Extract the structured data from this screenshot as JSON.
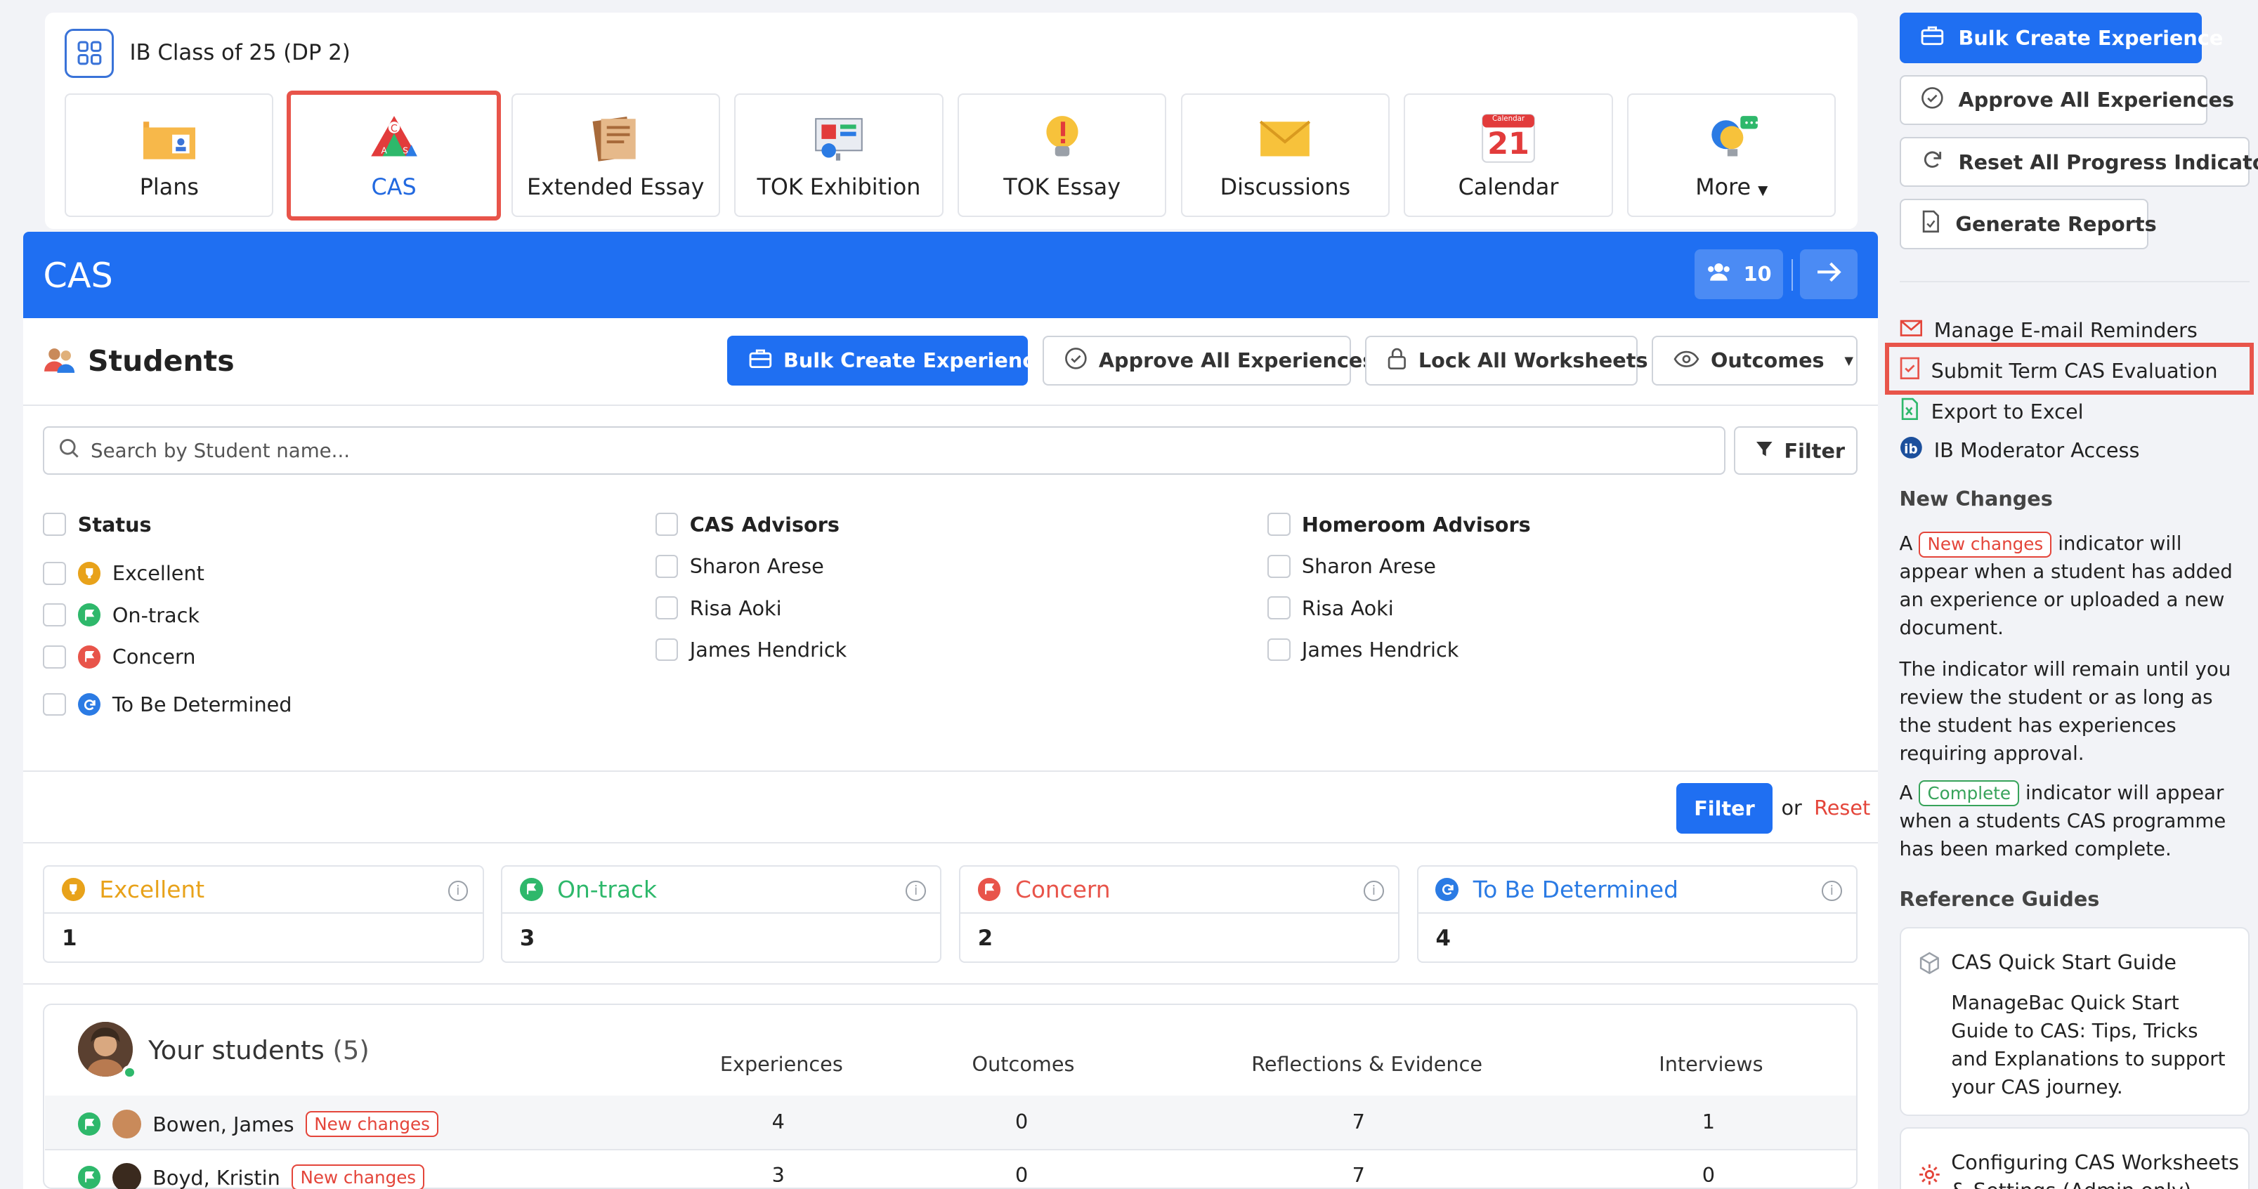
{
  "header": {
    "class_title": "IB Class of 25 (DP 2)",
    "tiles": [
      {
        "label": "Plans",
        "icon": "plans-folder-icon"
      },
      {
        "label": "CAS",
        "icon": "cas-triangle-icon"
      },
      {
        "label": "Extended Essay",
        "icon": "extended-essay-book-icon"
      },
      {
        "label": "TOK Exhibition",
        "icon": "tok-exhibition-board-icon"
      },
      {
        "label": "TOK Essay",
        "icon": "tok-essay-bulb-icon"
      },
      {
        "label": "Discussions",
        "icon": "discussions-envelope-icon"
      },
      {
        "label": "Calendar",
        "icon": "calendar-icon"
      },
      {
        "label": "More",
        "icon": "more-bulb-chat-icon"
      }
    ],
    "calendar_day": "21",
    "calendar_month": "Calendar"
  },
  "cas": {
    "title": "CAS",
    "student_count": "10",
    "students_title": "Students",
    "buttons": {
      "bulk_create": "Bulk Create Experience",
      "approve_all": "Approve All Experiences",
      "lock_all": "Lock All Worksheets",
      "outcomes": "Outcomes"
    },
    "search_placeholder": "Search by Student name...",
    "filter_label": "Filter",
    "filters": {
      "status": {
        "title": "Status",
        "items": [
          "Excellent",
          "On-track",
          "Concern",
          "To Be Determined"
        ]
      },
      "cas_advisors": {
        "title": "CAS Advisors",
        "items": [
          "Sharon Arese",
          "Risa Aoki",
          "James Hendrick"
        ]
      },
      "homeroom_advisors": {
        "title": "Homeroom Advisors",
        "items": [
          "Sharon Arese",
          "Risa Aoki",
          "James Hendrick"
        ]
      }
    },
    "apply_filter": "Filter",
    "or_text": "or",
    "reset": "Reset",
    "stats": [
      {
        "label": "Excellent",
        "value": "1",
        "color": "#e8a21a"
      },
      {
        "label": "On-track",
        "value": "3",
        "color": "#2eb86b"
      },
      {
        "label": "Concern",
        "value": "2",
        "color": "#e8544a"
      },
      {
        "label": "To Be Determined",
        "value": "4",
        "color": "#2b7be4"
      }
    ],
    "your_students": {
      "title": "Your students",
      "count": "(5)",
      "columns": [
        "Experiences",
        "Outcomes",
        "Reflections & Evidence",
        "Interviews"
      ],
      "rows": [
        {
          "name": "Bowen, James",
          "badge": "New changes",
          "experiences": "4",
          "outcomes": "0",
          "reflections": "7",
          "interviews": "1"
        },
        {
          "name": "Boyd, Kristin",
          "badge": "New changes",
          "experiences": "3",
          "outcomes": "0",
          "reflections": "7",
          "interviews": "0"
        }
      ]
    }
  },
  "sidebar": {
    "buttons": {
      "bulk_create": "Bulk Create Experience",
      "approve_all": "Approve All Experiences",
      "reset_progress": "Reset All Progress Indicators",
      "generate_reports": "Generate Reports"
    },
    "links": {
      "email_reminders": "Manage E-mail Reminders",
      "submit_term": "Submit Term CAS Evaluation",
      "export_excel": "Export to Excel",
      "moderator": "IB Moderator Access"
    },
    "new_changes": {
      "title": "New Changes",
      "p1_a": "A",
      "p1_badge": "New changes",
      "p1_b": "indicator will appear when a student has added an experience or uploaded a new document.",
      "p2": "The indicator will remain until you review the student or as long as the student has experiences requiring approval.",
      "p3_a": "A",
      "p3_badge": "Complete",
      "p3_b": "indicator will appear when a students CAS programme has been marked complete."
    },
    "reference_guides": {
      "title": "Reference Guides",
      "guide1_title": "CAS Quick Start Guide",
      "guide1_desc": "ManageBac Quick Start Guide to CAS: Tips, Tricks and Explanations to support your CAS journey.",
      "guide2_title": "Configuring CAS Worksheets & Settings (Admin only)"
    }
  }
}
